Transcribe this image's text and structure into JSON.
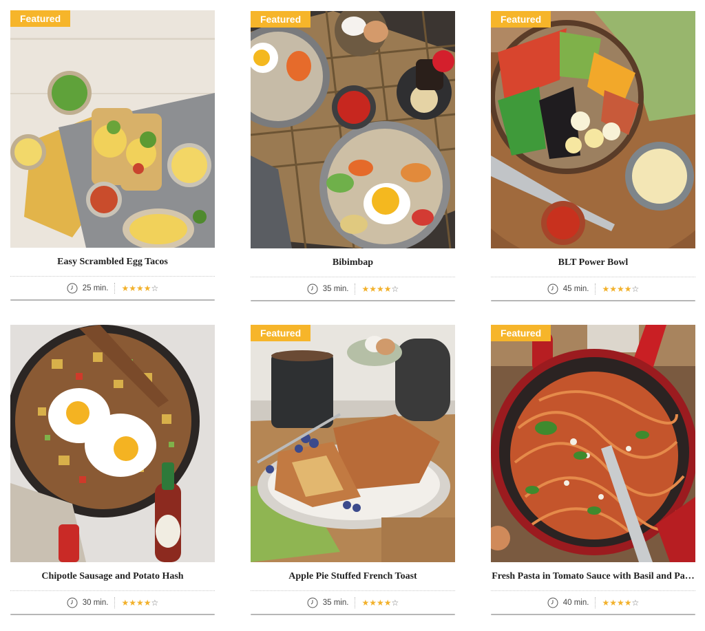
{
  "featured_label": "Featured",
  "recipes": [
    {
      "title": "Easy Scrambled Egg Tacos",
      "time": "25 min.",
      "rating": 4,
      "featured": true
    },
    {
      "title": "Bibimbap",
      "time": "35 min.",
      "rating": 4,
      "featured": true
    },
    {
      "title": "BLT Power Bowl",
      "time": "45 min.",
      "rating": 4,
      "featured": true
    },
    {
      "title": "Chipotle Sausage and Potato Hash",
      "time": "30 min.",
      "rating": 4,
      "featured": false
    },
    {
      "title": "Apple Pie Stuffed French Toast",
      "time": "35 min.",
      "rating": 4,
      "featured": true
    },
    {
      "title": "Fresh Pasta in Tomato Sauce with Basil and Pa…",
      "time": "40 min.",
      "rating": 4,
      "featured": true
    }
  ],
  "rating_max": 5,
  "icons": {
    "time": "clock-icon",
    "rating": "star-icon"
  },
  "colors": {
    "badge": "#f6b52a",
    "star": "#f2b12b"
  }
}
